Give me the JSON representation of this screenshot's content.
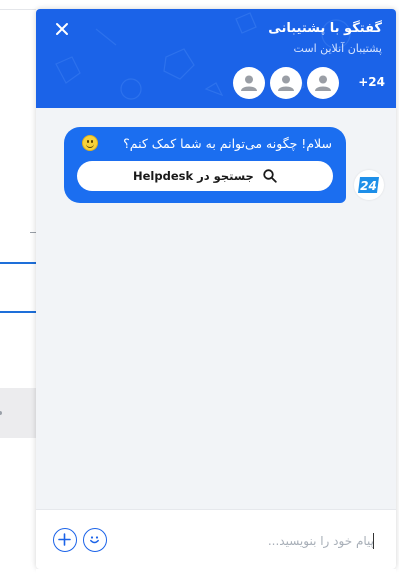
{
  "header": {
    "title": "گفتگو با پشتیبانی",
    "subtitle": "پشتیبان آنلاین است",
    "agent_count": "+24",
    "close_label": "×"
  },
  "messages": [
    {
      "text": "سلام! چگونه می‌توانم به شما کمک کنم؟",
      "button_label": "جستجو در Helpdesk"
    }
  ],
  "bot": {
    "logo_text": "24"
  },
  "composer": {
    "placeholder": "پیام خود را بنویسید...",
    "value": ""
  },
  "colors": {
    "header_bg": "#1b63e8",
    "bubble_bg": "#1b6ef0",
    "accent": "#1b63e8"
  },
  "icons": [
    "close-icon",
    "user-icon",
    "search-icon",
    "smiley-icon",
    "add-icon",
    "bot-logo-icon"
  ]
}
